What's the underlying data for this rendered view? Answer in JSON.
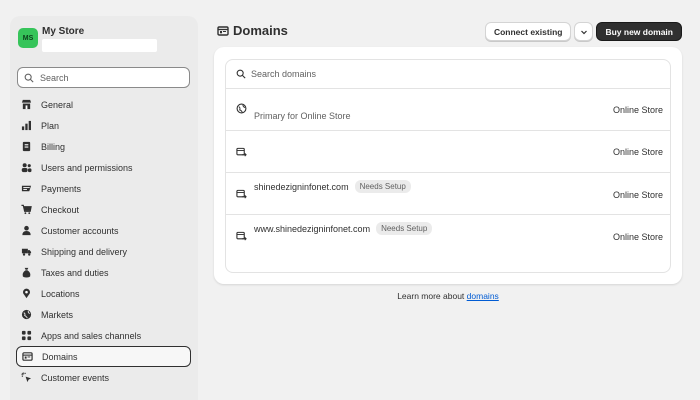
{
  "store": {
    "initials": "MS",
    "name": "My Store"
  },
  "sidebar": {
    "search_placeholder": "Search",
    "items": [
      {
        "label": "General",
        "icon": "store-icon"
      },
      {
        "label": "Plan",
        "icon": "plan-chart-icon"
      },
      {
        "label": "Billing",
        "icon": "billing-receipt-icon"
      },
      {
        "label": "Users and permissions",
        "icon": "users-icon"
      },
      {
        "label": "Payments",
        "icon": "payments-icon"
      },
      {
        "label": "Checkout",
        "icon": "cart-icon"
      },
      {
        "label": "Customer accounts",
        "icon": "person-icon"
      },
      {
        "label": "Shipping and delivery",
        "icon": "truck-icon"
      },
      {
        "label": "Taxes and duties",
        "icon": "money-bag-icon"
      },
      {
        "label": "Locations",
        "icon": "location-pin-icon"
      },
      {
        "label": "Markets",
        "icon": "globe-icon"
      },
      {
        "label": "Apps and sales channels",
        "icon": "apps-grid-icon"
      },
      {
        "label": "Domains",
        "icon": "domain-icon",
        "active": true
      },
      {
        "label": "Customer events",
        "icon": "sparkle-cursor-icon"
      }
    ]
  },
  "header": {
    "title": "Domains",
    "connect_label": "Connect existing",
    "buy_label": "Buy new domain"
  },
  "domains": {
    "search_placeholder": "Search domains",
    "rows": [
      {
        "name": "",
        "badge": "",
        "subtitle": "Primary for Online Store",
        "channel": "Online Store",
        "icon": "globe-icon"
      },
      {
        "name": "",
        "badge": "",
        "subtitle": "",
        "channel": "Online Store",
        "icon": "redirect-icon"
      },
      {
        "name": "shinedezigninfonet.com",
        "badge": "Needs Setup",
        "subtitle": "",
        "channel": "Online Store",
        "icon": "redirect-icon"
      },
      {
        "name": "www.shinedezigninfonet.com",
        "badge": "Needs Setup",
        "subtitle": "",
        "channel": "Online Store",
        "icon": "redirect-icon"
      }
    ]
  },
  "footer": {
    "text": "Learn more about",
    "link": "domains"
  },
  "colors": {
    "accent": "#303030",
    "avatar": "#36c45a",
    "link": "#005bd3",
    "background": "#f1f1f1"
  }
}
